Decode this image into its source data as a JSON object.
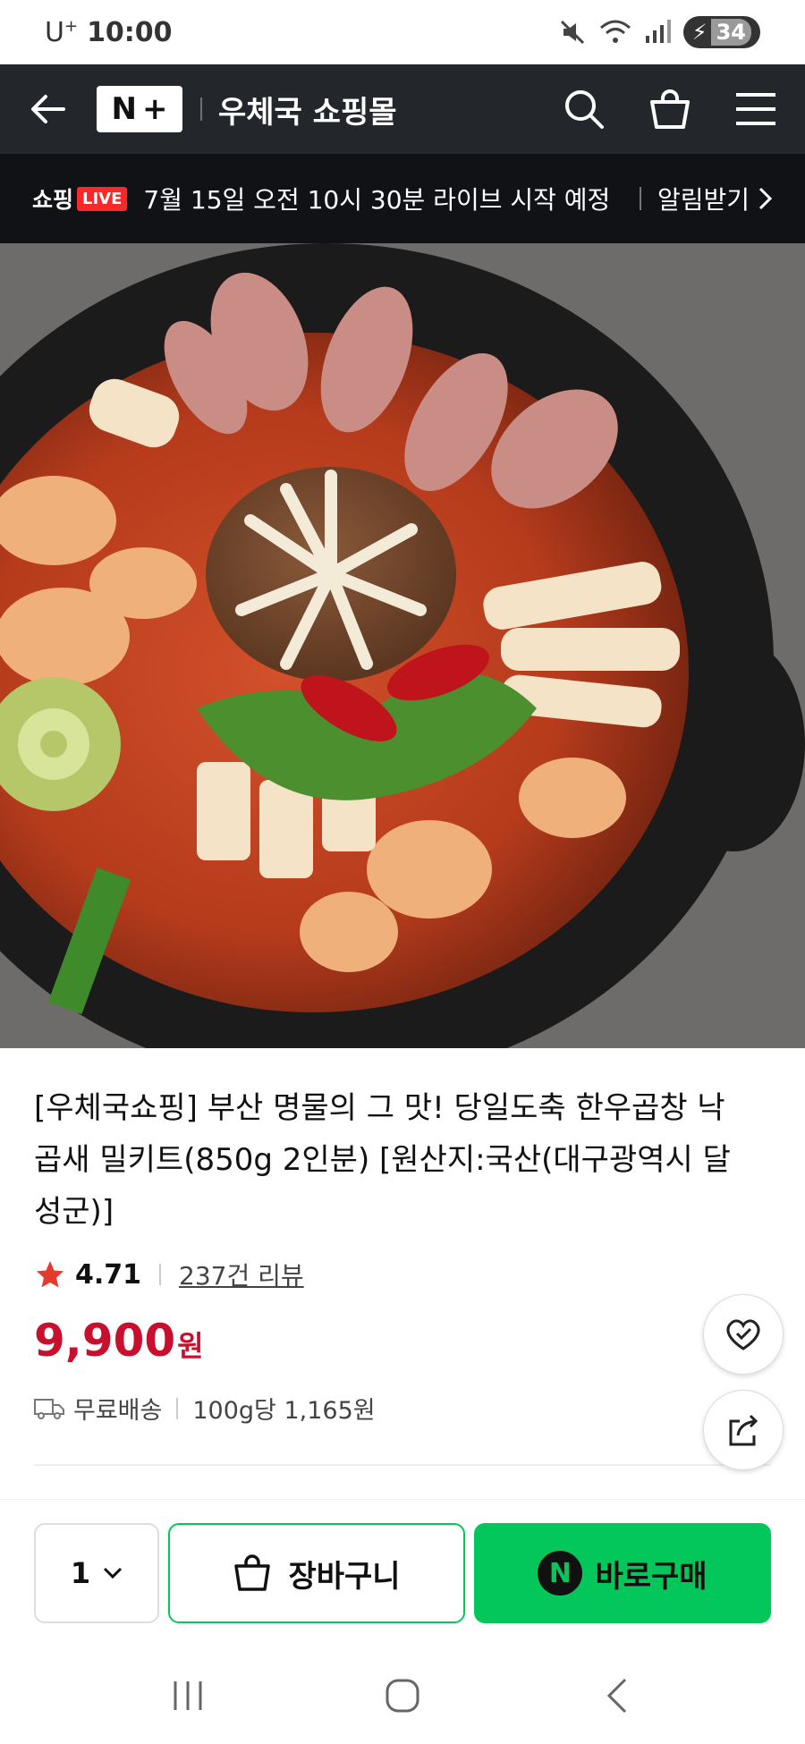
{
  "status_bar": {
    "carrier": "U",
    "carrier_sup": "+",
    "time": "10:00",
    "battery": "34"
  },
  "header": {
    "logo_left": "N",
    "logo_right": "+",
    "store_name": "우체국 쇼핑몰"
  },
  "live_banner": {
    "shop_label": "쇼핑",
    "live_label": "LIVE",
    "text": "7월 15일 오전 10시 30분 라이브 시작 예정",
    "notify_label": "알림받기"
  },
  "product": {
    "title": "[우체국쇼핑] 부산 명물의 그 맛! 당일도축 한우곱창 낙곱새 밀키트(850g 2인분) [원산지:국산(대구광역시 달성군)]",
    "rating": "4.71",
    "review_count": "237건 리뷰",
    "price": "9,900",
    "price_unit": "원",
    "shipping": "무료배송",
    "unit_price": "100g당 1,165원"
  },
  "actions": {
    "quantity": "1",
    "cart_label": "장바구니",
    "buy_icon": "N",
    "buy_label": "바로구매"
  },
  "colors": {
    "accent": "#03c75a",
    "price": "#c8102e",
    "header_bg": "#23262b",
    "live_red": "#fa2828"
  },
  "icons": [
    "back-arrow-icon",
    "search-icon",
    "cart-icon",
    "menu-icon",
    "chevron-right-icon",
    "star-icon",
    "truck-icon",
    "heart-check-icon",
    "share-icon",
    "chevron-down-icon",
    "shopping-bag-icon",
    "recent-apps-icon",
    "home-icon",
    "back-icon"
  ]
}
